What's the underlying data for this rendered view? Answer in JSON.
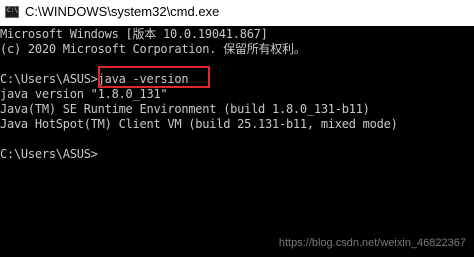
{
  "window": {
    "title": "C:\\WINDOWS\\system32\\cmd.exe",
    "icon": "cmd-icon",
    "icon_text": "C:\\"
  },
  "console": {
    "lines": [
      "Microsoft Windows [版本 10.0.19041.867]",
      "(c) 2020 Microsoft Corporation. 保留所有权利。",
      "",
      "C:\\Users\\ASUS>java -version",
      "java version \"1.8.0_131\"",
      "Java(TM) SE Runtime Environment (build 1.8.0_131-b11)",
      "Java HotSpot(TM) Client VM (build 25.131-b11, mixed mode)",
      "",
      "C:\\Users\\ASUS>"
    ]
  },
  "colors": {
    "console_background": "#000000",
    "console_text": "#c8c8c8",
    "highlight_border": "#e0282a"
  },
  "watermark": "https://blog.csdn.net/weixin_46822367"
}
